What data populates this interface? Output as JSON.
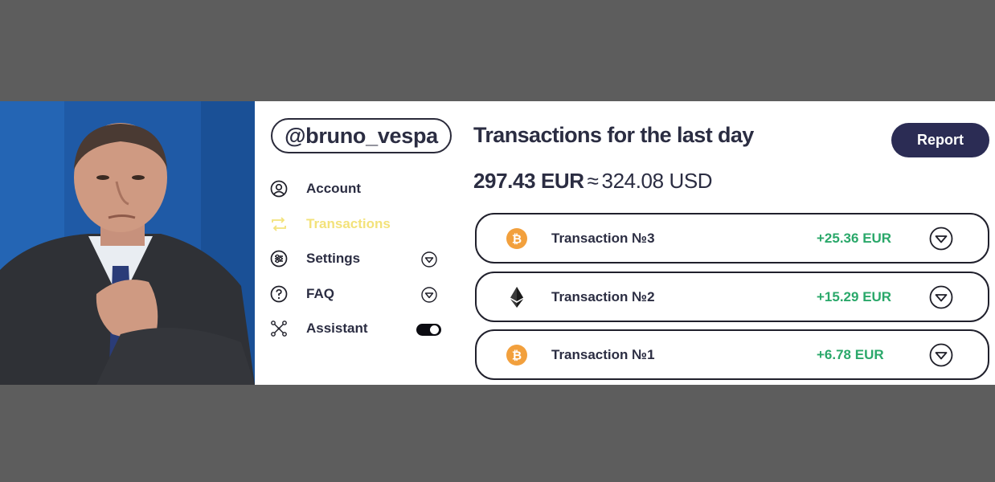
{
  "profile": {
    "handle": "@bruno_vespa"
  },
  "menu": {
    "items": [
      {
        "label": "Account",
        "icon": "user-circle-icon",
        "active": false
      },
      {
        "label": "Transactions",
        "icon": "repeat-arrows-icon",
        "active": true
      },
      {
        "label": "Settings",
        "icon": "sliders-icon",
        "active": false,
        "expandable": true
      },
      {
        "label": "FAQ",
        "icon": "question-circle-icon",
        "active": false,
        "expandable": true
      },
      {
        "label": "Assistant",
        "icon": "network-nodes-icon",
        "active": false,
        "toggle": true,
        "toggle_on": true
      }
    ]
  },
  "main": {
    "title": "Transactions for the last day",
    "report_label": "Report",
    "total_eur": "297.43 EUR",
    "approx_symbol": "≈",
    "total_usd": "324.08 USD"
  },
  "transactions": [
    {
      "name": "Transaction №3",
      "amount": "+25.36 EUR",
      "coin_icon": "bitcoin-icon"
    },
    {
      "name": "Transaction №2",
      "amount": "+15.29 EUR",
      "coin_icon": "ethereum-icon"
    },
    {
      "name": "Transaction №1",
      "amount": "+6.78 EUR",
      "coin_icon": "bitcoin-icon"
    }
  ],
  "colors": {
    "background": "#5d5d5d",
    "text_dark": "#2b2d42",
    "active_menu": "#f3e27a",
    "amount_green": "#2aa86a",
    "button_bg": "#2b2c54",
    "bitcoin_orange": "#f2a03d"
  }
}
